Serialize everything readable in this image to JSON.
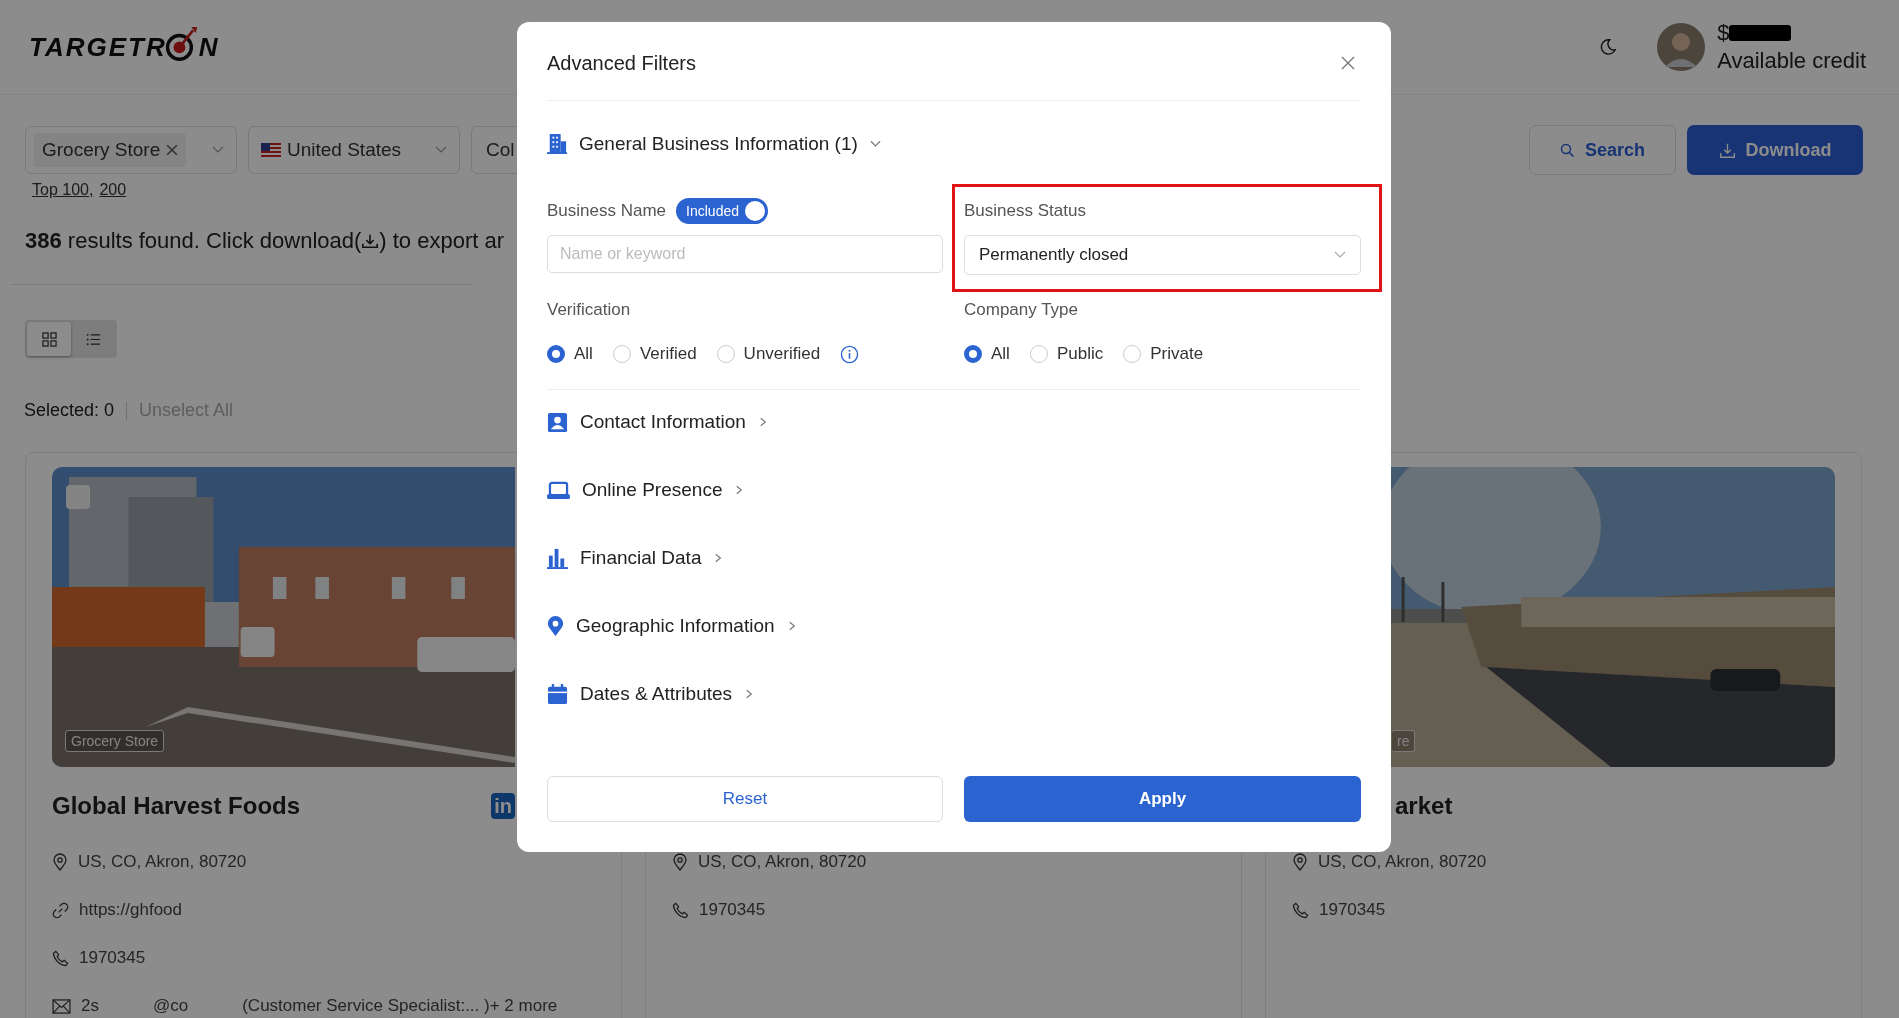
{
  "header": {
    "logo": {
      "before": "TARGETR",
      "after": "N"
    },
    "credit": {
      "amount": "$",
      "label": "Available credit"
    }
  },
  "filters": [
    {
      "kind": "tag",
      "value": "Grocery Store"
    },
    {
      "kind": "flag",
      "value": "United States"
    },
    {
      "kind": "plain",
      "value": "Col"
    }
  ],
  "filter_links": [
    "Top 100,",
    "200"
  ],
  "actions": [
    {
      "kind": "search",
      "label": "Search"
    },
    {
      "kind": "download",
      "label": "Download"
    }
  ],
  "results": {
    "before": "**386** results found. Click download(",
    "after": ") to export ar"
  },
  "view_modes": [
    {
      "kind": "grid",
      "selected": true
    },
    {
      "kind": "list",
      "selected": false
    }
  ],
  "selection": {
    "label": "Selected: 0",
    "action": "Unselect All"
  },
  "cards": [
    {
      "checked": false,
      "tag": "Grocery Store",
      "title": "Global Harvest Foods",
      "badge": "in",
      "lines": [
        {
          "kind": "address",
          "parts": [
            "US, CO, Akron, 80720"
          ]
        },
        {
          "kind": "website",
          "parts": [
            "https://ghfood"
          ]
        },
        {
          "kind": "phone",
          "parts": [
            "1970345"
          ]
        },
        {
          "kind": "email",
          "parts": [
            "2s",
            "@co",
            "(Customer Service Specialist:... )+ 2 more"
          ]
        }
      ]
    },
    {
      "lines": [
        {
          "kind": "address",
          "parts": [
            "US, CO, Akron, 80720"
          ]
        },
        {
          "kind": "phone",
          "parts": [
            "1970345"
          ]
        }
      ]
    },
    {
      "tag": "re",
      "title": "arket",
      "lines": [
        {
          "kind": "address",
          "parts": [
            "US, CO, Akron, 80720"
          ]
        },
        {
          "kind": "phone",
          "parts": [
            "1970345"
          ]
        }
      ]
    }
  ],
  "modal": {
    "title": "Advanced Filters",
    "general": {
      "label": "General Business Information (1)",
      "expanded": true
    },
    "business_name": {
      "label": "Business Name",
      "toggle": {
        "label": "Included",
        "on": true
      },
      "placeholder": "Name or keyword"
    },
    "business_status": {
      "label": "Business Status",
      "value": "Permanently closed",
      "highlighted": true
    },
    "verification": {
      "label": "Verification",
      "options": [
        {
          "label": "All",
          "selected": true
        },
        {
          "label": "Verified",
          "selected": false
        },
        {
          "label": "Unverified",
          "selected": false
        }
      ]
    },
    "company_type": {
      "label": "Company Type",
      "options": [
        {
          "label": "All",
          "selected": true
        },
        {
          "label": "Public",
          "selected": false
        },
        {
          "label": "Private",
          "selected": false
        }
      ]
    },
    "sections": [
      {
        "kind": "contact",
        "label": "Contact Information",
        "expanded": false
      },
      {
        "kind": "online",
        "label": "Online Presence",
        "expanded": false
      },
      {
        "kind": "financial",
        "label": "Financial Data",
        "expanded": false
      },
      {
        "kind": "geographic",
        "label": "Geographic Information",
        "expanded": false
      },
      {
        "kind": "dates",
        "label": "Dates & Attributes",
        "expanded": false
      }
    ],
    "buttons": [
      {
        "kind": "secondary",
        "label": "Reset"
      },
      {
        "kind": "primary",
        "label": "Apply"
      }
    ]
  }
}
